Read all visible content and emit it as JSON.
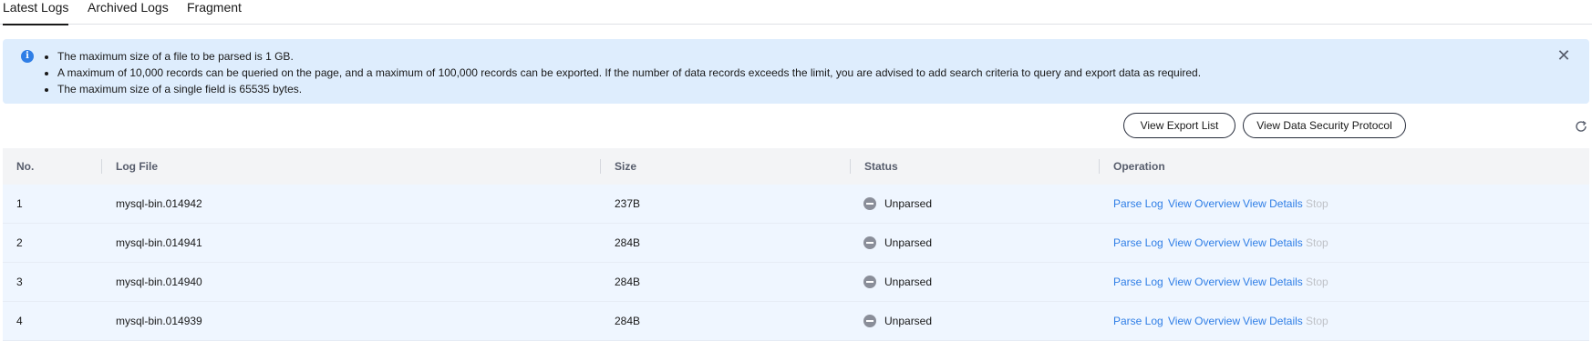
{
  "tabs": [
    {
      "label": "Latest Logs",
      "active": true
    },
    {
      "label": "Archived Logs",
      "active": false
    },
    {
      "label": "Fragment",
      "active": false
    }
  ],
  "notice": {
    "icon": "info-icon",
    "items": [
      "The maximum size of a file to be parsed is 1 GB.",
      "A maximum of 10,000 records can be queried on the page, and a maximum of 100,000 records can be exported. If the number of data records exceeds the limit, you are advised to add search criteria to query and export data as required.",
      "The maximum size of a single field is 65535 bytes."
    ],
    "close_icon": "close-icon"
  },
  "toolbar": {
    "view_export_list": "View Export List",
    "view_data_security_protocol": "View Data Security Protocol",
    "refresh_icon": "refresh-icon"
  },
  "table": {
    "columns": [
      "No.",
      "Log File",
      "Size",
      "Status",
      "Operation"
    ],
    "rows": [
      {
        "no": "1",
        "log_file": "mysql-bin.014942",
        "size": "237B",
        "status": "Unparsed"
      },
      {
        "no": "2",
        "log_file": "mysql-bin.014941",
        "size": "284B",
        "status": "Unparsed"
      },
      {
        "no": "3",
        "log_file": "mysql-bin.014940",
        "size": "284B",
        "status": "Unparsed"
      },
      {
        "no": "4",
        "log_file": "mysql-bin.014939",
        "size": "284B",
        "status": "Unparsed"
      }
    ],
    "operations": {
      "parse_log": "Parse Log",
      "view_overview": "View Overview",
      "view_details": "View Details",
      "stop": "Stop"
    }
  },
  "colors": {
    "accent": "#2f7ee6",
    "notice_bg": "#deedfd",
    "row_bg": "#eff6ff",
    "disabled": "#bfc2c8"
  }
}
